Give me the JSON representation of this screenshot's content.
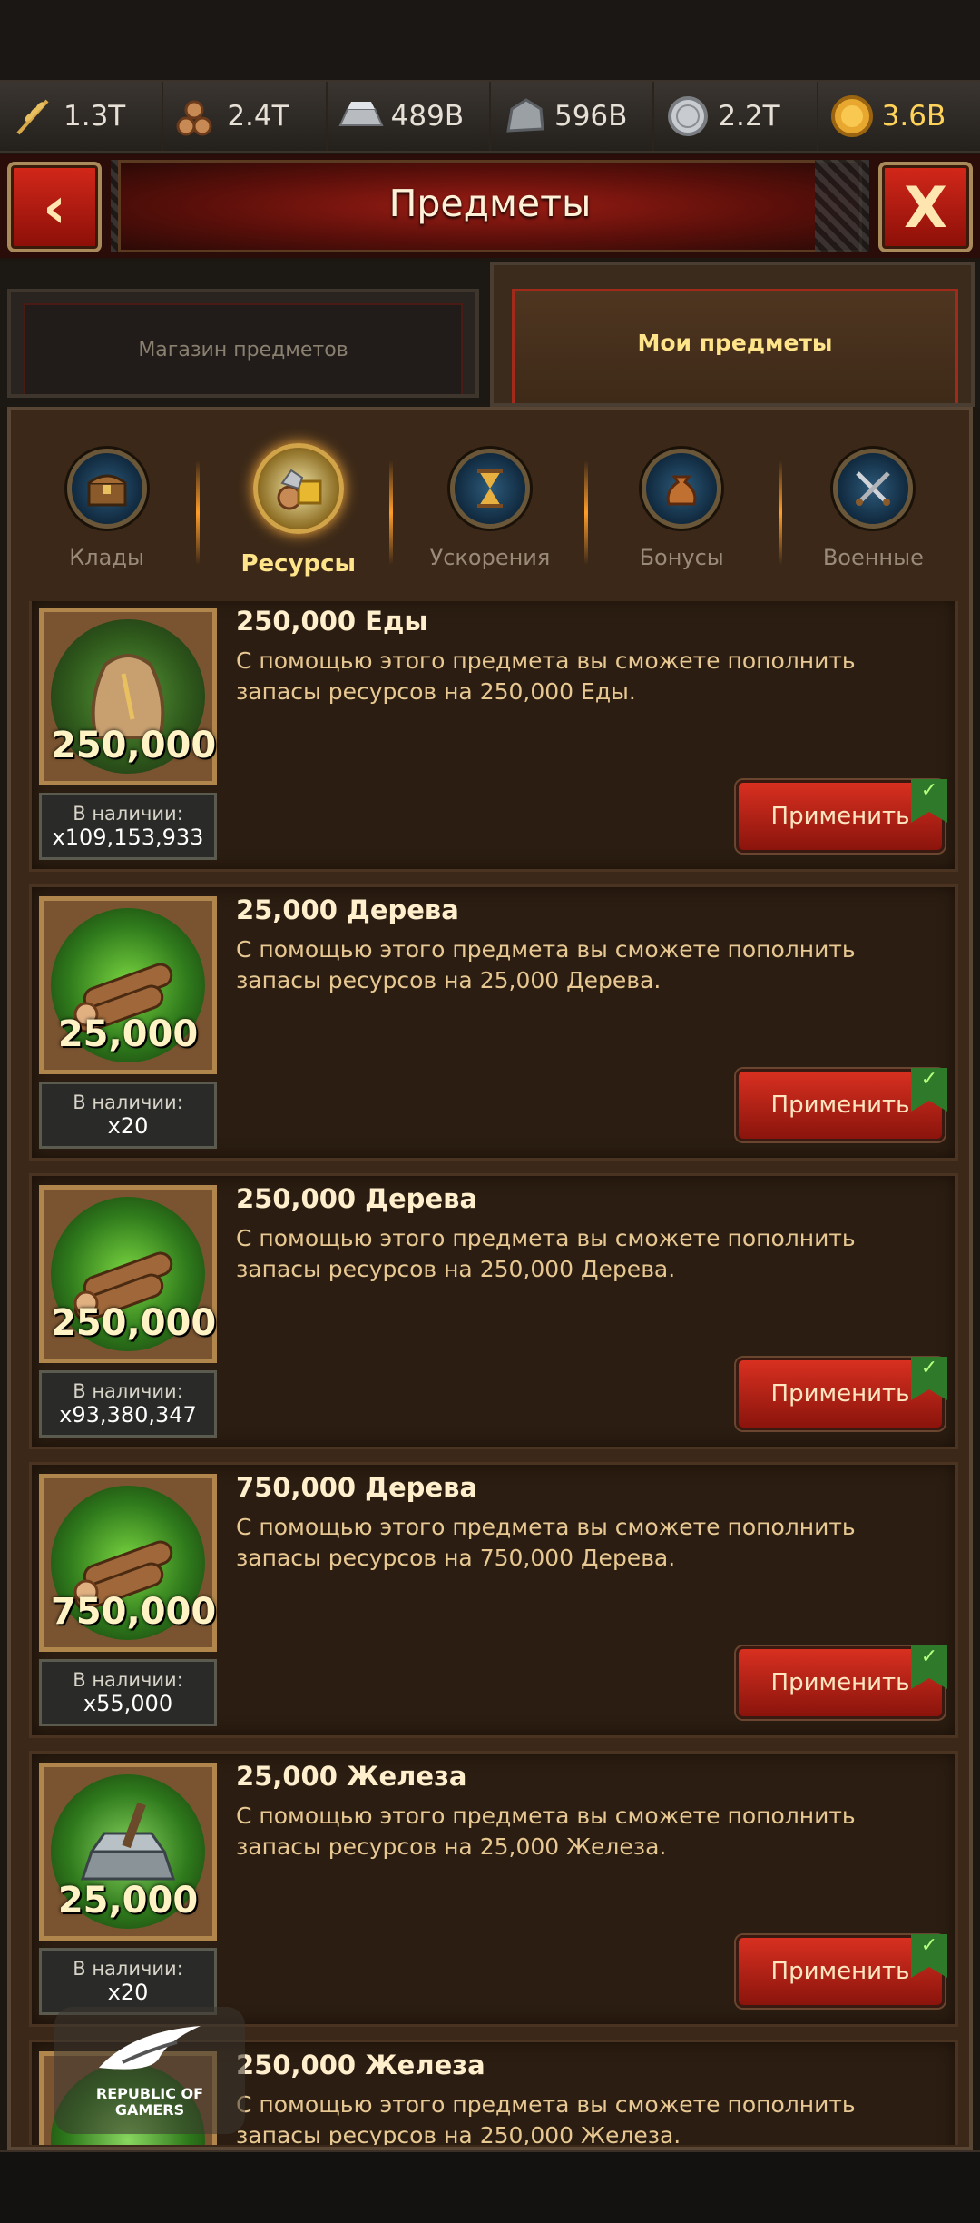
{
  "resources": [
    {
      "icon": "wheat-icon",
      "value": "1.3T"
    },
    {
      "icon": "wood-logs-icon",
      "value": "2.4T"
    },
    {
      "icon": "iron-ingot-icon",
      "value": "489B"
    },
    {
      "icon": "stone-icon",
      "value": "596B"
    },
    {
      "icon": "silver-coin-icon",
      "value": "2.2T"
    },
    {
      "icon": "gold-coin-icon",
      "value": "3.6B"
    }
  ],
  "header": {
    "title": "Предметы",
    "back_label": "‹",
    "close_label": "X"
  },
  "tabs": {
    "shop": "Магазин предметов",
    "mine": "Мои предметы"
  },
  "categories": [
    {
      "label": "Клады",
      "icon": "chest-icon"
    },
    {
      "label": "Ресурсы",
      "icon": "resources-icon"
    },
    {
      "label": "Ускорения",
      "icon": "hourglass-icon"
    },
    {
      "label": "Бонусы",
      "icon": "bag-icon"
    },
    {
      "label": "Военные",
      "icon": "swords-icon"
    }
  ],
  "stock_label": "В наличии:",
  "apply_label": "Применить",
  "items": [
    {
      "title": "250,000 Еды",
      "desc": "С помощью этого предмета вы сможете пополнить запасы ресурсов на 250,000 Еды.",
      "amount": "250,000",
      "stock": "x109,153,933",
      "kind": "food"
    },
    {
      "title": "25,000 Дерева",
      "desc": "С помощью этого предмета вы сможете пополнить запасы ресурсов на 25,000 Дерева.",
      "amount": "25,000",
      "stock": "x20",
      "kind": "wood"
    },
    {
      "title": "250,000 Дерева",
      "desc": "С помощью этого предмета вы сможете пополнить запасы ресурсов на 250,000 Дерева.",
      "amount": "250,000",
      "stock": "x93,380,347",
      "kind": "wood"
    },
    {
      "title": "750,000 Дерева",
      "desc": "С помощью этого предмета вы сможете пополнить запасы ресурсов на 750,000 Дерева.",
      "amount": "750,000",
      "stock": "x55,000",
      "kind": "wood"
    },
    {
      "title": "25,000 Железа",
      "desc": "С помощью этого предмета вы сможете пополнить запасы ресурсов на 25,000 Железа.",
      "amount": "25,000",
      "stock": "x20",
      "kind": "iron"
    },
    {
      "title": "250,000 Железа",
      "desc": "С помощью этого предмета вы сможете пополнить запасы ресурсов на 250,000 Железа.",
      "amount": "",
      "stock": "",
      "kind": "iron"
    }
  ],
  "watermark": {
    "line1": "REPUBLIC OF",
    "line2": "GAMERS"
  }
}
